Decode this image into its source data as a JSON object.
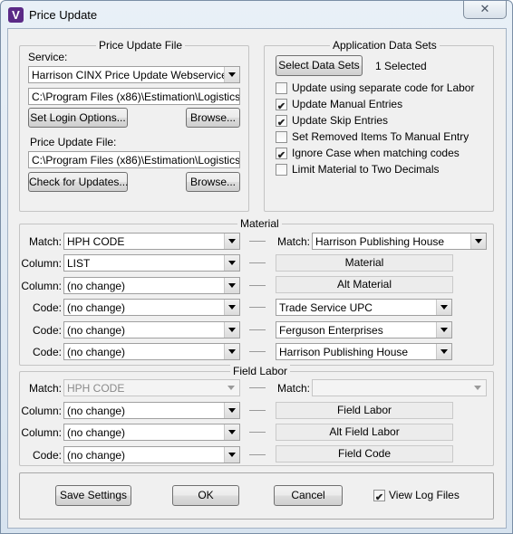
{
  "window": {
    "title": "Price Update",
    "app_icon": "V",
    "close_glyph": "✕"
  },
  "price_update_file": {
    "group_label": "Price Update File",
    "service_label": "Service:",
    "service_value": "Harrison CINX Price Update Webservice",
    "service_path": "C:\\Program Files (x86)\\Estimation\\Logistics\\Estim",
    "set_login_label": "Set Login Options...",
    "browse1_label": "Browse...",
    "file_label": "Price Update File:",
    "file_path": "C:\\Program Files (x86)\\Estimation\\Logistics\\Estim",
    "check_updates_label": "Check for Updates...",
    "browse2_label": "Browse..."
  },
  "app_data_sets": {
    "group_label": "Application Data Sets",
    "select_button_label": "Select Data Sets",
    "selected_text": "1 Selected",
    "options": [
      {
        "label": "Update using separate code for Labor",
        "checked": false
      },
      {
        "label": "Update Manual Entries",
        "checked": true
      },
      {
        "label": "Update Skip Entries",
        "checked": true
      },
      {
        "label": "Set Removed Items To Manual Entry",
        "checked": false
      },
      {
        "label": "Ignore Case when matching codes",
        "checked": true
      },
      {
        "label": "Limit Material to Two Decimals",
        "checked": false
      }
    ]
  },
  "material": {
    "group_label": "Material",
    "rows": [
      {
        "left_label": "Match:",
        "left_value": "HPH CODE",
        "right_label": "Match:",
        "right_value": "Harrison Publishing House"
      },
      {
        "left_label": "Column:",
        "left_value": "LIST",
        "right_field": "Material"
      },
      {
        "left_label": "Column:",
        "left_value": "(no change)",
        "right_field": "Alt Material"
      },
      {
        "left_label": "Code:",
        "left_value": "(no change)",
        "right_value": "Trade Service UPC"
      },
      {
        "left_label": "Code:",
        "left_value": "(no change)",
        "right_value": "Ferguson Enterprises"
      },
      {
        "left_label": "Code:",
        "left_value": "(no change)",
        "right_value": "Harrison Publishing House"
      }
    ]
  },
  "field_labor": {
    "group_label": "Field Labor",
    "rows": [
      {
        "left_label": "Match:",
        "left_value": "HPH CODE",
        "right_label": "Match:",
        "right_value": ""
      },
      {
        "left_label": "Column:",
        "left_value": "(no change)",
        "right_field": "Field Labor"
      },
      {
        "left_label": "Column:",
        "left_value": "(no change)",
        "right_field": "Alt Field Labor"
      },
      {
        "left_label": "Code:",
        "left_value": "(no change)",
        "right_field": "Field Code"
      }
    ]
  },
  "footer": {
    "save_label": "Save Settings",
    "ok_label": "OK",
    "cancel_label": "Cancel",
    "view_log_label": "View Log Files",
    "view_log_checked": true
  }
}
